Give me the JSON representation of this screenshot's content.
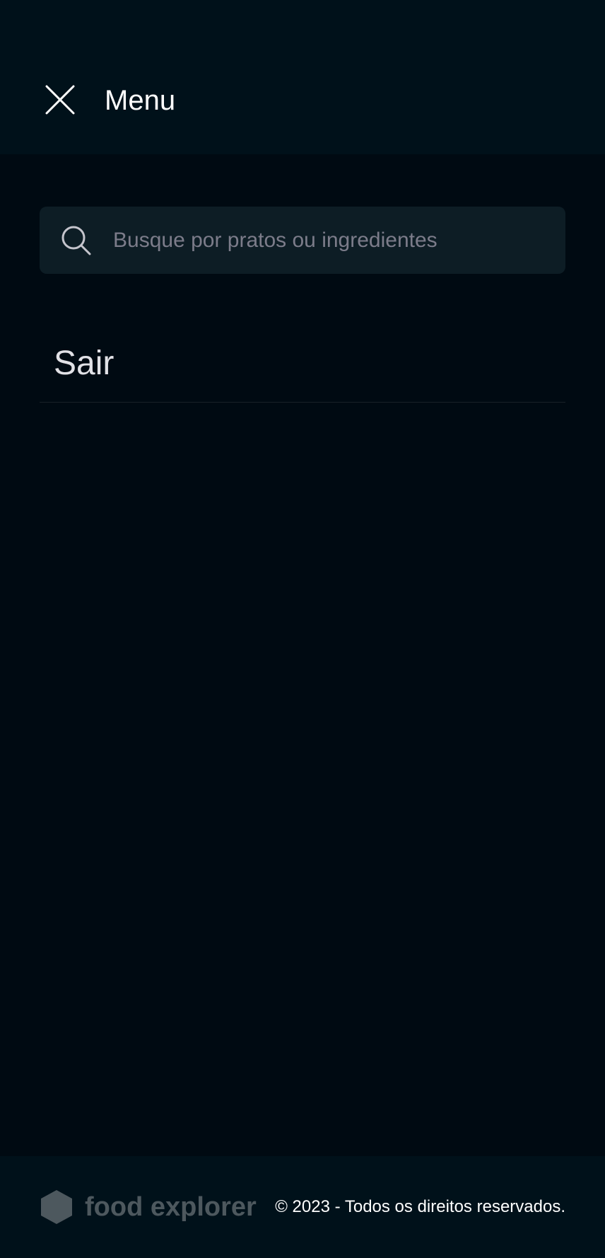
{
  "header": {
    "title": "Menu",
    "close_icon": "close-icon"
  },
  "search": {
    "placeholder": "Busque por pratos ou ingredientes",
    "value": "",
    "icon": "search-icon"
  },
  "menu": {
    "items": [
      {
        "label": "Sair"
      }
    ]
  },
  "footer": {
    "logo_text": "food explorer",
    "logo_icon": "hexagon-logo-icon",
    "copyright": "© 2023 - Todos os direitos reservados."
  },
  "colors": {
    "background": "#000a12",
    "header_bg": "#00111a",
    "search_bg": "#0d1d25",
    "placeholder": "#7c7c8a",
    "logo_gray": "#4d585e",
    "text_light": "#e1e1e6"
  }
}
